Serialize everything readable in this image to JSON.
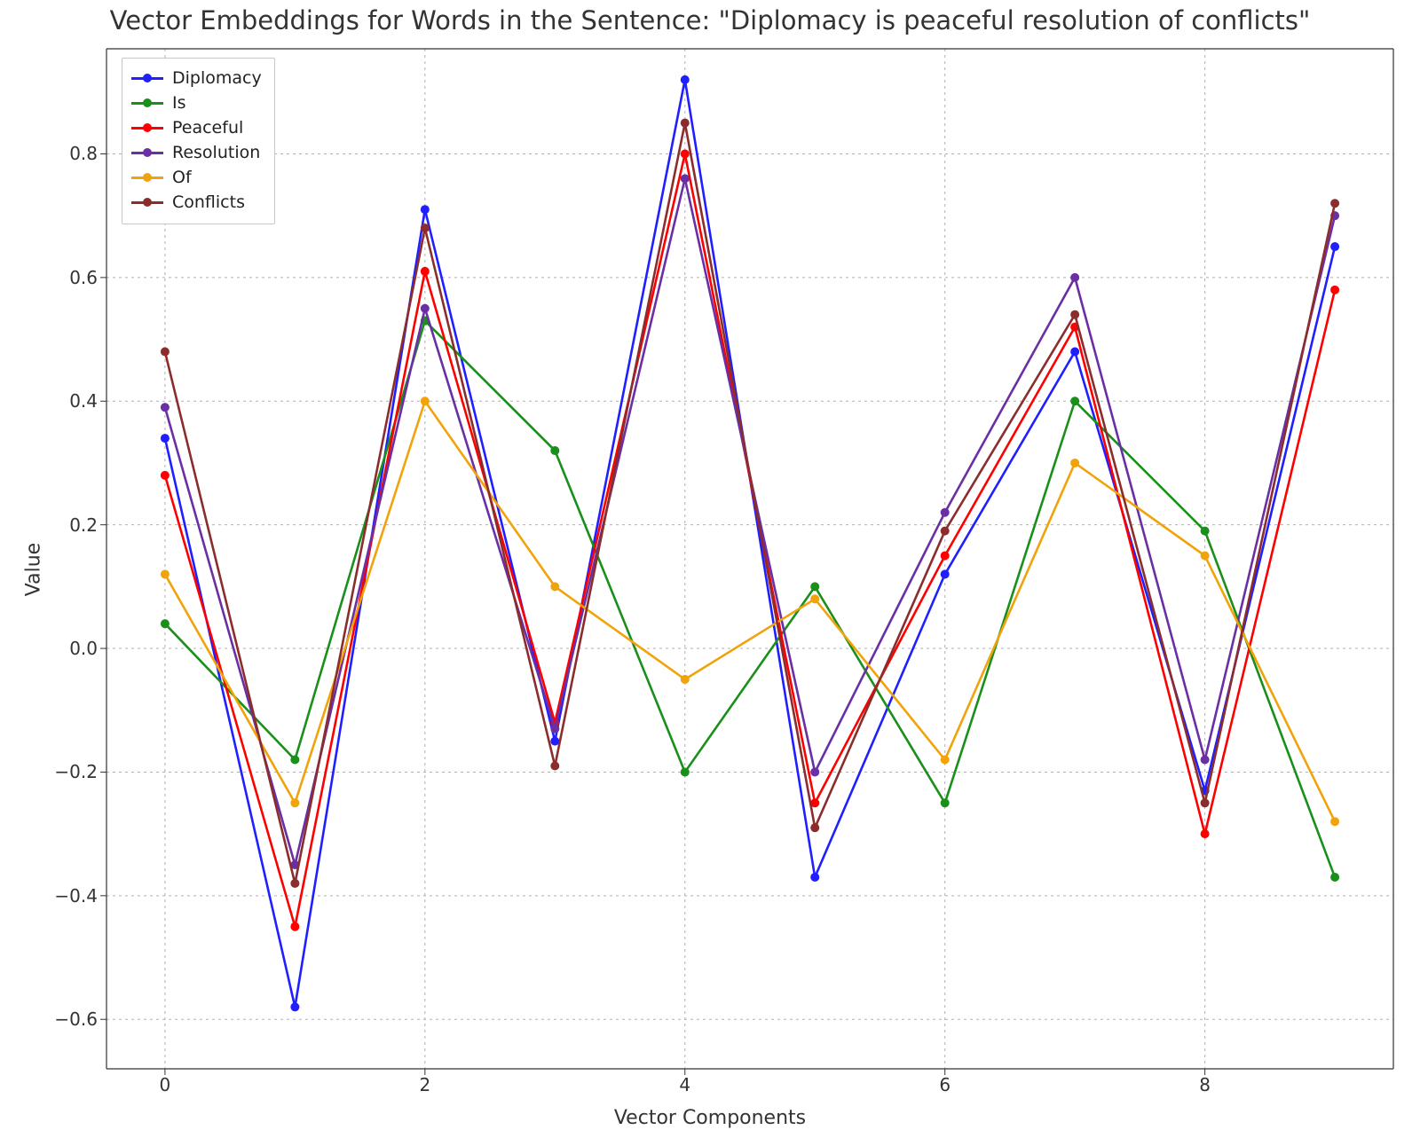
{
  "chart_data": {
    "type": "line",
    "title": "Vector Embeddings for Words in the Sentence: \"Diplomacy is peaceful resolution of conflicts\"",
    "xlabel": "Vector Components",
    "ylabel": "Value",
    "xticks": [
      0,
      2,
      4,
      6,
      8
    ],
    "yticks": [
      -0.6,
      -0.4,
      -0.2,
      0.0,
      0.2,
      0.4,
      0.6,
      0.8
    ],
    "ylim": [
      -0.68,
      0.97
    ],
    "xlim": [
      -0.45,
      9.45
    ],
    "x": [
      0,
      1,
      2,
      3,
      4,
      5,
      6,
      7,
      8,
      9
    ],
    "series": [
      {
        "name": "Diplomacy",
        "color": "#1f1fff",
        "values": [
          0.34,
          -0.58,
          0.71,
          -0.15,
          0.92,
          -0.37,
          0.12,
          0.48,
          -0.23,
          0.65
        ]
      },
      {
        "name": "Is",
        "color": "#1a8f1a",
        "values": [
          0.04,
          -0.18,
          0.53,
          0.32,
          -0.2,
          0.1,
          -0.25,
          0.4,
          0.19,
          -0.37
        ]
      },
      {
        "name": "Peaceful",
        "color": "#ff0000",
        "values": [
          0.28,
          -0.45,
          0.61,
          -0.12,
          0.8,
          -0.25,
          0.15,
          0.52,
          -0.3,
          0.58
        ]
      },
      {
        "name": "Resolution",
        "color": "#6a2fa5",
        "values": [
          0.39,
          -0.35,
          0.55,
          -0.13,
          0.76,
          -0.2,
          0.22,
          0.6,
          -0.18,
          0.7
        ]
      },
      {
        "name": "Of",
        "color": "#f0a30a",
        "values": [
          0.12,
          -0.25,
          0.4,
          0.1,
          -0.05,
          0.08,
          -0.18,
          0.3,
          0.15,
          -0.28
        ]
      },
      {
        "name": "Conflicts",
        "color": "#8b2d2d",
        "values": [
          0.48,
          -0.38,
          0.68,
          -0.19,
          0.85,
          -0.29,
          0.19,
          0.54,
          -0.25,
          0.72
        ]
      }
    ],
    "legend_position": "upper-left",
    "grid": true
  }
}
